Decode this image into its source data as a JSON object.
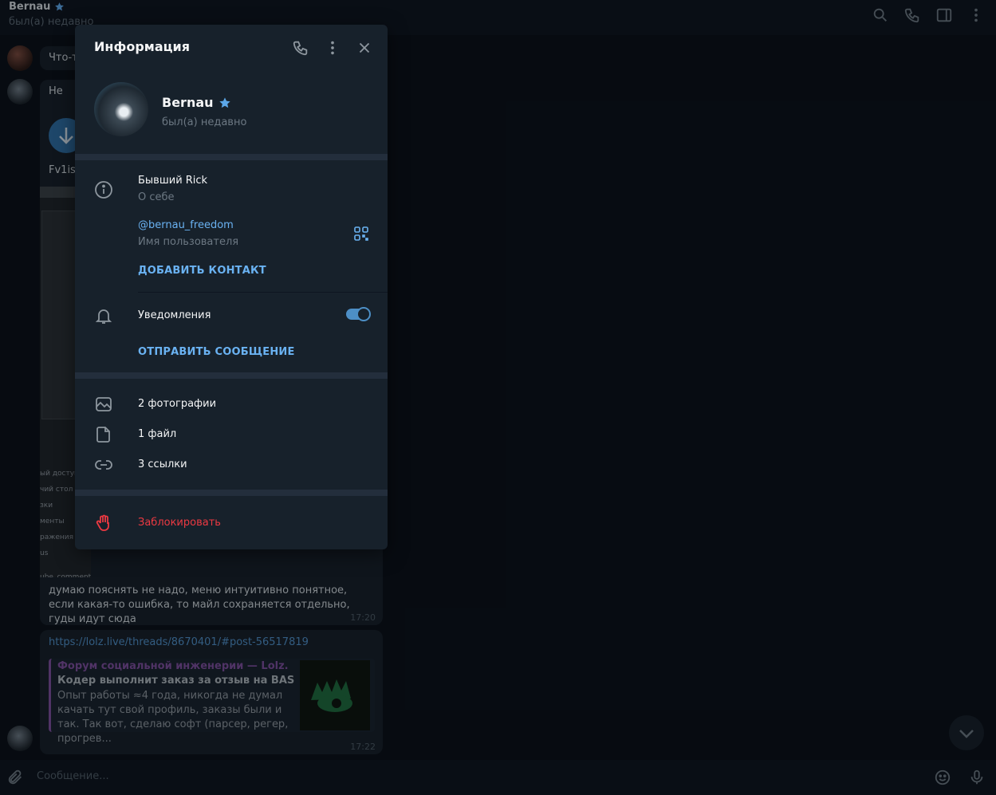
{
  "header": {
    "name": "Bernau",
    "status": "был(а) недавно",
    "icons": [
      "search-icon",
      "phone-icon",
      "sidebar-icon",
      "more-icon"
    ]
  },
  "chat": {
    "msg1_preview": "Что-т",
    "msg2_preview": "Не",
    "file_name_preview": "Fv1isc",
    "screenshot_lines": [
      "ый доступ",
      "чий стол",
      "зки",
      "менты",
      "ражения",
      "us",
      "ube_comments"
    ],
    "msg3_text": "думаю пояснять не надо, меню интуитивно понятное, если какая-то ошибка, то майл сохраняется отдельно, гуды идут сюда",
    "msg3_time": "17:20",
    "link_url": "https://lolz.live/threads/8670401/#post-56517819",
    "link_site": "Форум социальной инженерии — Lolz.live...",
    "link_title": "Кодер выполнит заказ за отзыв на BAS",
    "link_desc": "Опыт работы ≈4 года, никогда не думал качать тут свой профиль, заказы были и так. Так вот, сделаю софт (парсер, регер, прогрев...",
    "link_time": "17:22"
  },
  "input": {
    "placeholder": "Сообщение..."
  },
  "panel": {
    "title": "Информация",
    "profile_name": "Bernau",
    "profile_status": "был(а) недавно",
    "bio": "Бывший Rick",
    "bio_label": "О себе",
    "username": "@bernau_freedom",
    "username_label": "Имя пользователя",
    "add_contact": "ДОБАВИТЬ КОНТАКТ",
    "notifications": "Уведомления",
    "notifications_on": true,
    "send_message": "ОТПРАВИТЬ СООБЩЕНИЕ",
    "photos": "2 фотографии",
    "files": "1 файл",
    "links": "3 ссылки",
    "block": "Заблокировать"
  },
  "colors": {
    "accent": "#6ab2f2",
    "danger": "#ec3942",
    "panel_bg": "#17212b",
    "app_bg": "#0e1621",
    "premium_star": "#5ca7e8"
  }
}
